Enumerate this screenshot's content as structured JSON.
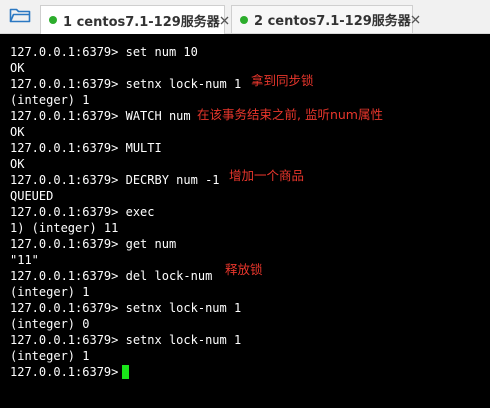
{
  "tabs": [
    {
      "label": "1 centos7.1-129服务器",
      "active": true
    },
    {
      "label": "2 centos7.1-129服务器",
      "active": false
    }
  ],
  "icons": {
    "folder": "folder-icon",
    "close": "close-icon",
    "status": "status-dot-icon"
  },
  "colors": {
    "terminal_bg": "#000000",
    "terminal_text": "#ffffff",
    "annotation": "#e8362c",
    "cursor": "#19e619",
    "status_dot": "#2cad2c"
  },
  "terminal": {
    "lines": [
      "127.0.0.1:6379> set num 10",
      "OK",
      "127.0.0.1:6379> setnx lock-num 1",
      "(integer) 1",
      "127.0.0.1:6379> WATCH num",
      "OK",
      "127.0.0.1:6379> MULTI",
      "OK",
      "127.0.0.1:6379> DECRBY num -1",
      "QUEUED",
      "127.0.0.1:6379> exec",
      "1) (integer) 11",
      "127.0.0.1:6379> get num",
      "\"11\"",
      "127.0.0.1:6379> del lock-num",
      "(integer) 1",
      "127.0.0.1:6379> setnx lock-num 1",
      "(integer) 0",
      "127.0.0.1:6379> setnx lock-num 1",
      "(integer) 1",
      "127.0.0.1:6379> "
    ]
  },
  "annotations": [
    "拿到同步锁",
    "在该事务结束之前, 监听num属性",
    "增加一个商品",
    "释放锁"
  ]
}
